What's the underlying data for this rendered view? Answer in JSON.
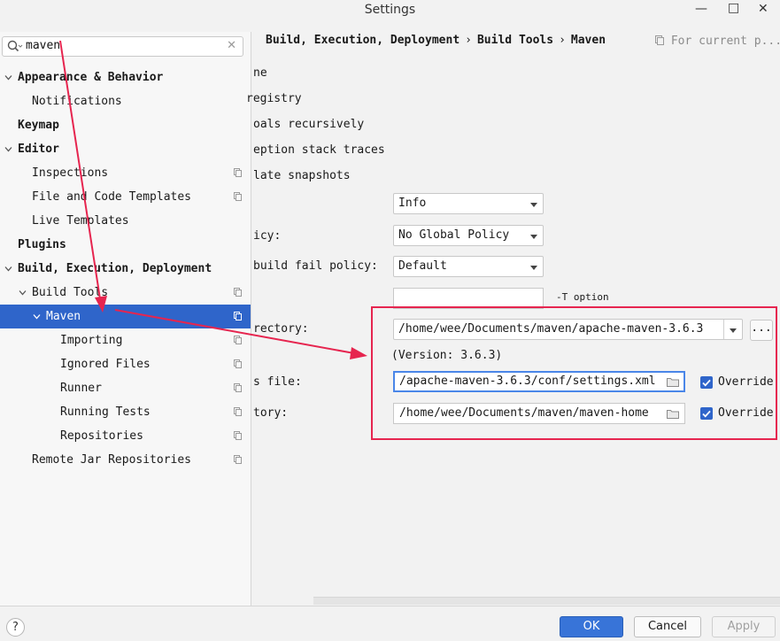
{
  "window": {
    "title": "Settings",
    "minimize_icon": "minimize-icon",
    "maximize_icon": "maximize-icon",
    "close_icon": "close-icon"
  },
  "search": {
    "value": "maven",
    "icon": "search-icon"
  },
  "tree": [
    {
      "label": "Appearance & Behavior",
      "bold": true,
      "expanded": true
    },
    {
      "label": "Notifications"
    },
    {
      "label": "Keymap",
      "bold": true
    },
    {
      "label": "Editor",
      "bold": true,
      "expanded": true
    },
    {
      "label": "Inspections"
    },
    {
      "label": "File and Code Templates"
    },
    {
      "label": "Live Templates"
    },
    {
      "label": "Plugins",
      "bold": true
    },
    {
      "label": "Build, Execution, Deployment",
      "bold": true,
      "expanded": true
    },
    {
      "label": "Build Tools",
      "expanded": true
    },
    {
      "label": "Maven",
      "selected": true,
      "expanded": true
    },
    {
      "label": "Importing"
    },
    {
      "label": "Ignored Files"
    },
    {
      "label": "Runner"
    },
    {
      "label": "Running Tests"
    },
    {
      "label": "Repositories"
    },
    {
      "label": "Remote Jar Repositories"
    }
  ],
  "breadcrumb": {
    "part1": "Build, Execution, Deployment",
    "part2": "Build Tools",
    "part3": "Maven",
    "separator": "›",
    "for_current": "For current p..."
  },
  "settings_rows": {
    "row1": "ne",
    "row2": "registry",
    "row3": "oals recursively",
    "row4": "eption stack traces",
    "row5": "late snapshots",
    "checksum_label": "icy:",
    "multiproject_label": "build fail policy:",
    "home_label": "rectory:",
    "settings_label": "s file:",
    "repo_label": "tory:"
  },
  "combos": {
    "output_level": "Info",
    "checksum_policy": "No Global Policy",
    "fail_policy": "Default"
  },
  "threads": {
    "value": "",
    "hint": "-T option"
  },
  "maven_home": {
    "value": "/home/wee/Documents/maven/apache-maven-3.6.3",
    "version": "(Version: 3.6.3)",
    "browse_label": "..."
  },
  "user_settings": {
    "value": "/apache-maven-3.6.3/conf/settings.xml",
    "override_label": "Override",
    "override_checked": true
  },
  "local_repo": {
    "value": "/home/wee/Documents/maven/maven-home",
    "override_label": "Override",
    "override_checked": true
  },
  "buttons": {
    "help": "?",
    "ok": "OK",
    "cancel": "Cancel",
    "apply": "Apply"
  },
  "colors": {
    "selection": "#2f65ca",
    "annotation": "#e6254f",
    "ok_button": "#3874d8"
  }
}
